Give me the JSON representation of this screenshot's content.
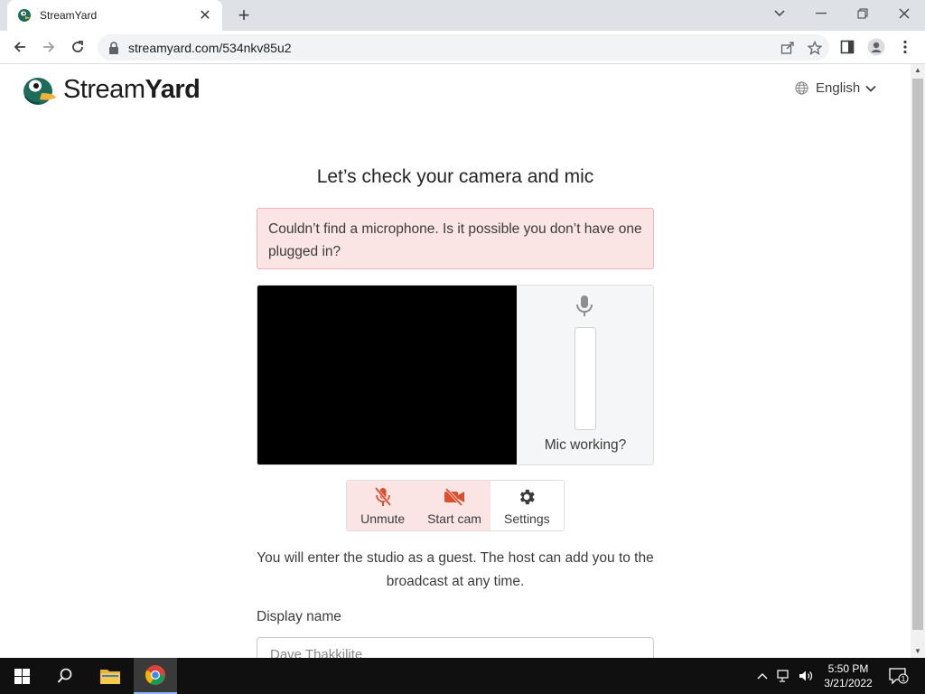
{
  "browser": {
    "tab_title": "StreamYard",
    "url": "streamyard.com/534nkv85u2",
    "new_tab_symbol": "+",
    "close_tab_symbol": "✕"
  },
  "header": {
    "logo_text_light": "Stream",
    "logo_text_bold": "Yard",
    "language": "English"
  },
  "main": {
    "heading": "Let’s check your camera and mic",
    "alert": "Couldn’t find a microphone. Is it possible you don’t have one plugged in?",
    "mic_label": "Mic working?",
    "controls": [
      {
        "label": "Unmute",
        "icon": "mic-off-icon"
      },
      {
        "label": "Start cam",
        "icon": "camera-off-icon"
      },
      {
        "label": "Settings",
        "icon": "gear-icon"
      }
    ],
    "guest_note": "You will enter the studio as a guest. The host can add you to the broadcast at any time.",
    "display_name_label": "Display name",
    "display_name_value": "Dave Thakkilite"
  },
  "taskbar": {
    "time": "5:50 PM",
    "date": "3/21/2022",
    "notification_count": "1"
  },
  "colors": {
    "alert_bg": "#fbe4e4",
    "alert_border": "#efb4b4",
    "control_off_icon": "#d9502f",
    "video_bg": "#000000"
  }
}
